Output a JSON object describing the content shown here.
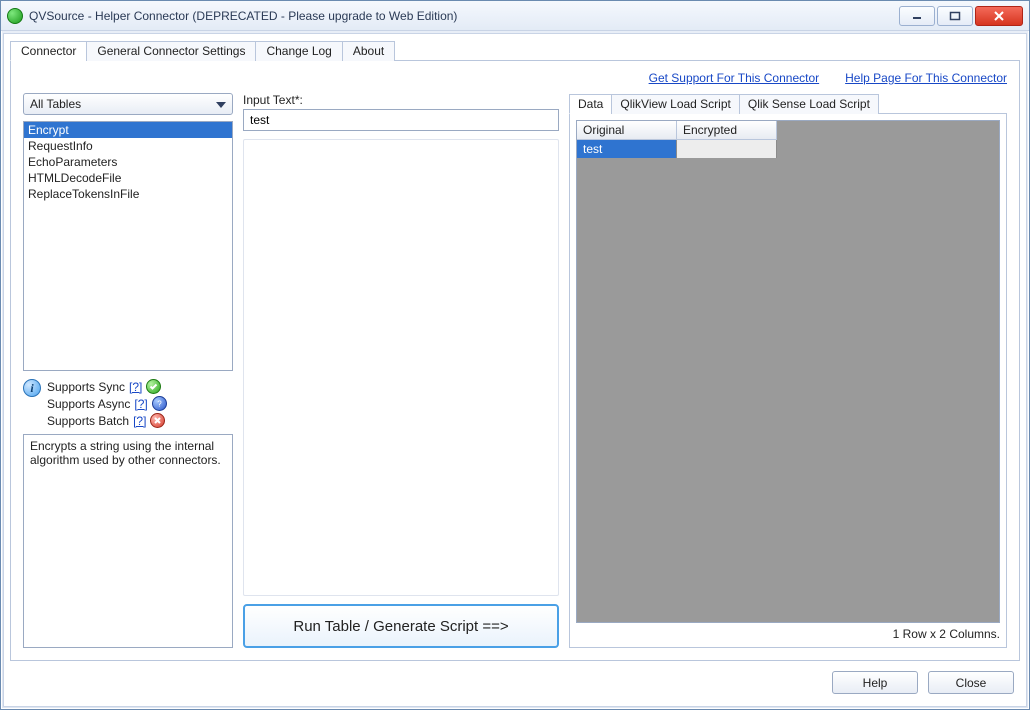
{
  "window": {
    "title": "QVSource - Helper Connector (DEPRECATED - Please upgrade to Web Edition)"
  },
  "tabs": {
    "main": [
      "Connector",
      "General Connector Settings",
      "Change Log",
      "About"
    ],
    "activeMain": "Connector",
    "sub": [
      "Data",
      "QlikView Load Script",
      "Qlik Sense Load Script"
    ],
    "activeSub": "Data"
  },
  "links": {
    "support": "Get Support For This Connector",
    "help": "Help Page For This Connector"
  },
  "left": {
    "comboLabel": "All Tables",
    "items": [
      "Encrypt",
      "RequestInfo",
      "EchoParameters",
      "HTMLDecodeFile",
      "ReplaceTokensInFile"
    ],
    "selected": "Encrypt",
    "supports": {
      "sync": {
        "label": "Supports Sync",
        "link": "[?]",
        "status": "green"
      },
      "async": {
        "label": "Supports Async",
        "link": "[?]",
        "status": "blue"
      },
      "batch": {
        "label": "Supports Batch",
        "link": "[?]",
        "status": "red"
      }
    },
    "description": "Encrypts a string using the internal algorithm used by other connectors."
  },
  "middle": {
    "inputLabel": "Input Text*:",
    "inputValue": "test",
    "runLabel": "Run Table / Generate Script ==>"
  },
  "right": {
    "columns": [
      "Original",
      "Encrypted"
    ],
    "rows": [
      {
        "Original": "test",
        "Encrypted": ""
      }
    ],
    "countText": "1 Row x 2 Columns."
  },
  "buttons": {
    "help": "Help",
    "close": "Close"
  }
}
